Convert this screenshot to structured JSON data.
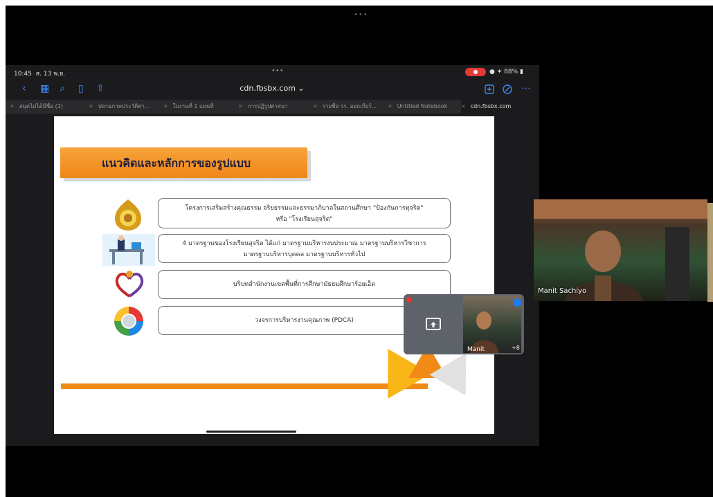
{
  "window": {
    "top_indicator": "•••"
  },
  "status_bar": {
    "time": "10:45",
    "date": "ส. 13 พ.ย.",
    "center": "•••",
    "battery": "88%"
  },
  "browser": {
    "url": "cdn.fbsbx.com",
    "tabs": [
      {
        "label": "สมุดไม่ได้มีชื่อ (1)",
        "active": false
      },
      {
        "label": "ปลายภาคประวัติศา...",
        "active": false
      },
      {
        "label": "ใบงานที่ 1 แผนที่",
        "active": false
      },
      {
        "label": "การปฏิรูปศาสนา",
        "active": false
      },
      {
        "label": "รายชื่อ รร. ออกเกียร์...",
        "active": false
      },
      {
        "label": "Untitled Notebook",
        "active": false
      },
      {
        "label": "cdn.fbsbx.com",
        "active": true
      }
    ]
  },
  "slide": {
    "title": "แนวคิดและหลักการของรูปแบบ",
    "rows": [
      {
        "lines": [
          "โครงการเสริมสร้างคุณธรรม จริยธรรมและธรรมาภิบาลในสถานศึกษา \"ป้องกันการทุจริต\"",
          "หรือ \"โรงเรียนสุจริต\""
        ]
      },
      {
        "lines": [
          "4 มาตรฐานของโรงเรียนสุจริต ได้แก่ มาตรฐานบริหารงบประมาณ มาตรฐานบริหารวิชาการ",
          "มาตรฐานบริหารบุคคล มาตรฐานบริหารทั่วไป"
        ]
      },
      {
        "lines": [
          "บริบทสำนักงานเขตพื้นที่การศึกษามัธยมศึกษาร้อยเอ็ด"
        ]
      },
      {
        "lines": [
          "วงจรการบริหารงานคุณภาพ (PDCA)"
        ]
      }
    ]
  },
  "self_view": {
    "name": "Manit",
    "extra_count": "+8"
  },
  "participant": {
    "name": "Manit Sachiyo"
  },
  "colors": {
    "accent_orange": "#f28a18",
    "link_blue": "#3d8bfd",
    "record_red": "#e53935"
  }
}
